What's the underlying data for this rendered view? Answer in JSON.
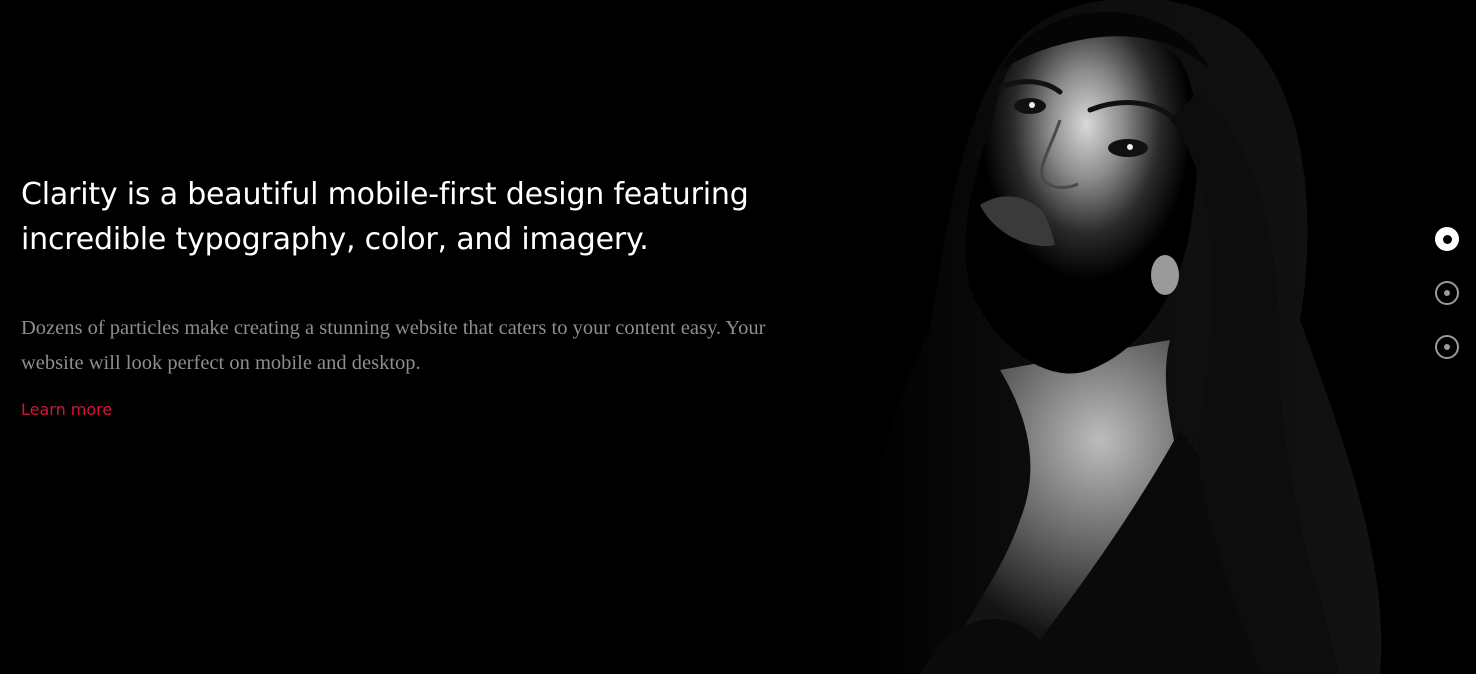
{
  "hero": {
    "headline": "Clarity is a beautiful mobile-first design featuring incredible typography, color, and imagery.",
    "description": "Dozens of particles make creating a stunning website that caters to your content easy. Your website will look perfect on mobile and desktop.",
    "link_label": "Learn more",
    "image": {
      "subject": "black-and-white portrait of a woman"
    }
  },
  "slider": {
    "slides": [
      {
        "active": true
      },
      {
        "active": false
      },
      {
        "active": false
      }
    ]
  },
  "colors": {
    "background": "#000000",
    "headline": "#ffffff",
    "description": "#8e8e8e",
    "link_accent": "#d7133c",
    "dot_active": "#ffffff",
    "dot_inactive": "#9a9a9a"
  }
}
